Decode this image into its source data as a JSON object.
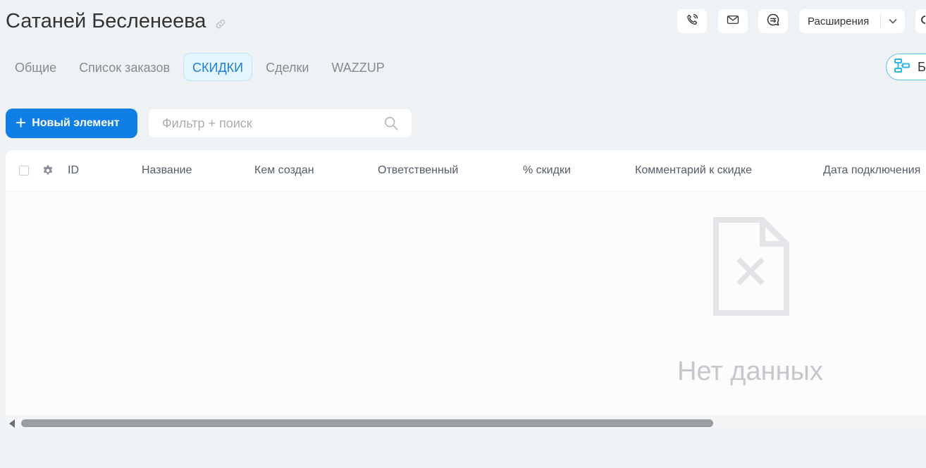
{
  "header": {
    "title": "Сатаней Бесленеева",
    "extensions_label": "Расширения"
  },
  "tabs": [
    {
      "label": "Общие",
      "active": false
    },
    {
      "label": "Список заказов",
      "active": false
    },
    {
      "label": "СКИДКИ",
      "active": true
    },
    {
      "label": "Сделки",
      "active": false
    },
    {
      "label": "WAZZUP",
      "active": false
    }
  ],
  "bp_button_label": "Б",
  "toolbar": {
    "add_label": "Новый элемент",
    "search_placeholder": "Фильтр + поиск"
  },
  "grid": {
    "columns": [
      "ID",
      "Название",
      "Кем создан",
      "Ответственный",
      "% скидки",
      "Комментарий к скидке",
      "Дата подключения"
    ],
    "rows": [],
    "empty_text": "Нет данных"
  },
  "colors": {
    "accent": "#0f7ee5",
    "active_tab_text": "#1e7fd8",
    "active_tab_bg": "#e5f5fd",
    "page_bg": "#eef2f4"
  },
  "icons": {
    "title": "link-icon",
    "tools": [
      "phone-icon",
      "mail-icon",
      "chat-icon"
    ],
    "bp": "business-process-icon",
    "search": "search-icon",
    "settings": "gear-icon",
    "empty": "empty-document-icon"
  }
}
